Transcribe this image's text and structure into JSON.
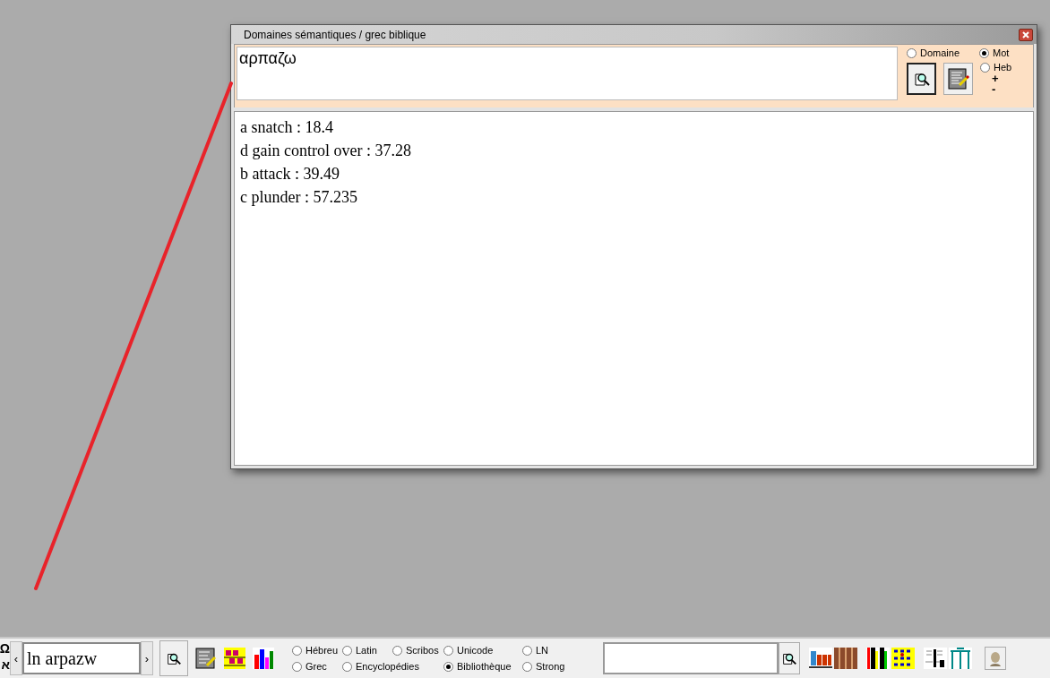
{
  "window": {
    "title": "Domaines sémantiques / grec biblique",
    "query": "αρπαζω",
    "options": [
      {
        "label": "Domaine",
        "selected": false
      },
      {
        "label": "Mot",
        "selected": true
      },
      {
        "label": "Heb",
        "selected": false
      }
    ],
    "zoom_in": "+",
    "zoom_out": "-",
    "results": [
      "a snatch : 18.4",
      "d gain control over : 37.28",
      "b attack : 39.49",
      "c plunder : 57.235"
    ]
  },
  "toolbar": {
    "glyphs": [
      "Ω",
      "א"
    ],
    "prev": "‹",
    "next": "›",
    "search_value": "ln arpazw",
    "option_rows": [
      [
        {
          "label": "Hébreu",
          "selected": false
        },
        {
          "label": "Latin",
          "selected": false
        },
        {
          "label": "Scribos",
          "selected": false
        },
        {
          "label": "Unicode",
          "selected": false
        },
        {
          "label": "LN",
          "selected": false
        }
      ],
      [
        {
          "label": "Grec",
          "selected": false
        },
        {
          "label": "Encyclopédies",
          "selected": false
        },
        {
          "label": "Bibliothèque",
          "selected": true
        },
        {
          "label": "Strong",
          "selected": false
        }
      ]
    ]
  }
}
